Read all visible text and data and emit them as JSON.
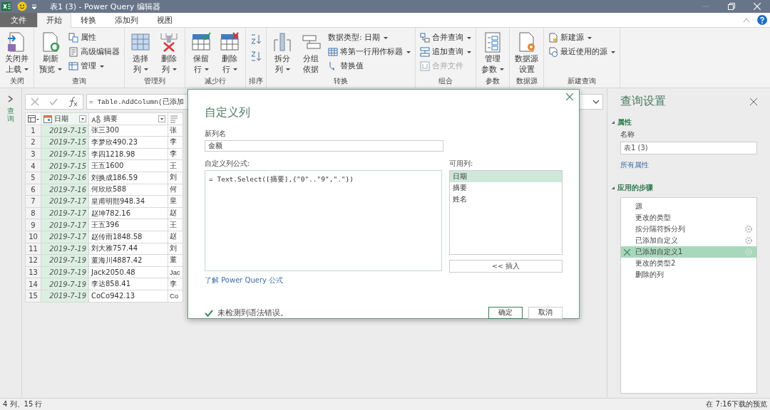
{
  "window": {
    "title": "表1 (3) - Power Query 编辑器"
  },
  "tabs": [
    {
      "label": "文件",
      "kind": "file",
      "selected": false
    },
    {
      "label": "开始",
      "kind": "tab",
      "selected": true
    },
    {
      "label": "转换",
      "kind": "tab",
      "selected": false
    },
    {
      "label": "添加列",
      "kind": "tab",
      "selected": false
    },
    {
      "label": "视图",
      "kind": "tab",
      "selected": false
    }
  ],
  "ribbon": {
    "groups": [
      {
        "label": "关闭",
        "items": [
          {
            "kind": "large",
            "lines": [
              "关闭并",
              "上载"
            ],
            "dropdown": true
          }
        ]
      },
      {
        "label": "查询",
        "items": [
          {
            "kind": "large",
            "lines": [
              "刷新",
              "预览"
            ],
            "dropdown": true
          },
          {
            "kind": "stack",
            "items": [
              {
                "label": "属性",
                "dropdown": false,
                "disabled": false
              },
              {
                "label": "高级编辑器",
                "dropdown": false,
                "disabled": false
              },
              {
                "label": "管理",
                "dropdown": true,
                "disabled": false
              }
            ]
          }
        ]
      },
      {
        "label": "管理列",
        "items": [
          {
            "kind": "large",
            "lines": [
              "选择",
              "列"
            ],
            "dropdown": true
          },
          {
            "kind": "large",
            "lines": [
              "删除",
              "列"
            ],
            "dropdown": true
          }
        ]
      },
      {
        "label": "减少行",
        "items": [
          {
            "kind": "large",
            "lines": [
              "保留",
              "行"
            ],
            "dropdown": true
          },
          {
            "kind": "large",
            "lines": [
              "删除",
              "行"
            ],
            "dropdown": true
          }
        ]
      },
      {
        "label": "排序",
        "items": [
          {
            "kind": "iconstack"
          }
        ]
      },
      {
        "label": "转换",
        "items": [
          {
            "kind": "large",
            "lines": [
              "拆分",
              "列"
            ],
            "dropdown": true
          },
          {
            "kind": "large",
            "lines": [
              "分组",
              "依据"
            ],
            "dropdown": false
          },
          {
            "kind": "stack",
            "items": [
              {
                "label": "数据类型: 日期",
                "dropdown": true,
                "disabled": false
              },
              {
                "label": "将第一行用作标题",
                "dropdown": true,
                "disabled": false
              },
              {
                "label": "替换值",
                "dropdown": false,
                "disabled": false
              }
            ]
          }
        ]
      },
      {
        "label": "组合",
        "items": [
          {
            "kind": "stack",
            "items": [
              {
                "label": "合并查询",
                "dropdown": true,
                "disabled": false
              },
              {
                "label": "追加查询",
                "dropdown": true,
                "disabled": false
              },
              {
                "label": "合并文件",
                "dropdown": false,
                "disabled": true
              }
            ]
          }
        ]
      },
      {
        "label": "参数",
        "items": [
          {
            "kind": "large",
            "lines": [
              "管理",
              "参数"
            ],
            "dropdown": true
          }
        ]
      },
      {
        "label": "数据源",
        "items": [
          {
            "kind": "large",
            "lines": [
              "数据源",
              "设置"
            ],
            "dropdown": false
          }
        ]
      },
      {
        "label": "新建查询",
        "items": [
          {
            "kind": "stack",
            "items": [
              {
                "label": "新建源",
                "dropdown": true,
                "disabled": false
              },
              {
                "label": "最近使用的源",
                "dropdown": true,
                "disabled": false
              }
            ]
          }
        ]
      }
    ]
  },
  "left_pane": {
    "label": "查询"
  },
  "formula_bar": {
    "formula": "= Table.AddColumn(已添加"
  },
  "table": {
    "columns": [
      {
        "label": "日期",
        "kind": "date",
        "selected": true
      },
      {
        "label": "摘要",
        "kind": "text",
        "selected": false
      },
      {
        "kind": "any",
        "selected": false
      }
    ],
    "rows": [
      {
        "n": "1",
        "cells": [
          "2019-7-15",
          "张三300",
          "张"
        ]
      },
      {
        "n": "2",
        "cells": [
          "2019-7-15",
          "李梦欣490.23",
          "李"
        ]
      },
      {
        "n": "3",
        "cells": [
          "2019-7-15",
          "李四1218.98",
          "李"
        ]
      },
      {
        "n": "4",
        "cells": [
          "2019-7-15",
          "王五1600",
          "王"
        ]
      },
      {
        "n": "5",
        "cells": [
          "2019-7-16",
          "刘换成186.59",
          "刘"
        ]
      },
      {
        "n": "6",
        "cells": [
          "2019-7-16",
          "何欣欣588",
          "何"
        ]
      },
      {
        "n": "7",
        "cells": [
          "2019-7-17",
          "皇甫明熙948.34",
          "皇"
        ]
      },
      {
        "n": "8",
        "cells": [
          "2019-7-17",
          "赵坤782.16",
          "赵"
        ]
      },
      {
        "n": "9",
        "cells": [
          "2019-7-17",
          "王五396",
          "王"
        ]
      },
      {
        "n": "10",
        "cells": [
          "2019-7-17",
          "赵传雨1848.58",
          "赵"
        ]
      },
      {
        "n": "11",
        "cells": [
          "2019-7-19",
          "刘大雅757.44",
          "刘"
        ]
      },
      {
        "n": "12",
        "cells": [
          "2019-7-19",
          "董海川4887.42",
          "董"
        ]
      },
      {
        "n": "13",
        "cells": [
          "2019-7-19",
          "Jack2050.48",
          "Jac"
        ]
      },
      {
        "n": "14",
        "cells": [
          "2019-7-19",
          "李达858.41",
          "李"
        ]
      },
      {
        "n": "15",
        "cells": [
          "2019-7-19",
          "CoCo942.13",
          "Co"
        ]
      }
    ]
  },
  "dialog": {
    "title": "自定义列",
    "name_label": "新列名",
    "name_value": "金额",
    "formula_label": "自定义列公式:",
    "formula": "= Text.Select([摘要],{\"0\"..\"9\",\".\"})",
    "columns_label": "可用列:",
    "columns": [
      {
        "label": "日期",
        "selected": true
      },
      {
        "label": "摘要",
        "selected": false
      },
      {
        "label": "姓名",
        "selected": false
      }
    ],
    "insert_button": "<< 插入",
    "help_link": "了解 Power Query 公式",
    "status": "未检测到语法错误。",
    "buttons": [
      {
        "label": "确定",
        "default": true
      },
      {
        "label": "取消",
        "default": false
      }
    ]
  },
  "query_settings": {
    "title": "查询设置",
    "properties_heading": "属性",
    "name_label": "名称",
    "name_value": "表1 (3)",
    "link": "所有属性",
    "steps_heading": "应用的步骤",
    "steps": [
      {
        "label": "源",
        "settings": false,
        "selected": false
      },
      {
        "label": "更改的类型",
        "settings": false,
        "selected": false
      },
      {
        "label": "按分隔符拆分列",
        "settings": true,
        "selected": false
      },
      {
        "label": "已添加自定义",
        "settings": true,
        "selected": false
      },
      {
        "label": "已添加自定义1",
        "settings": true,
        "selected": true
      },
      {
        "label": "更改的类型2",
        "settings": false,
        "selected": false
      },
      {
        "label": "删除的列",
        "settings": false,
        "selected": false
      }
    ]
  },
  "status_bar": {
    "left": "4 列、15 行",
    "right": "在 7:16下载的预览"
  }
}
